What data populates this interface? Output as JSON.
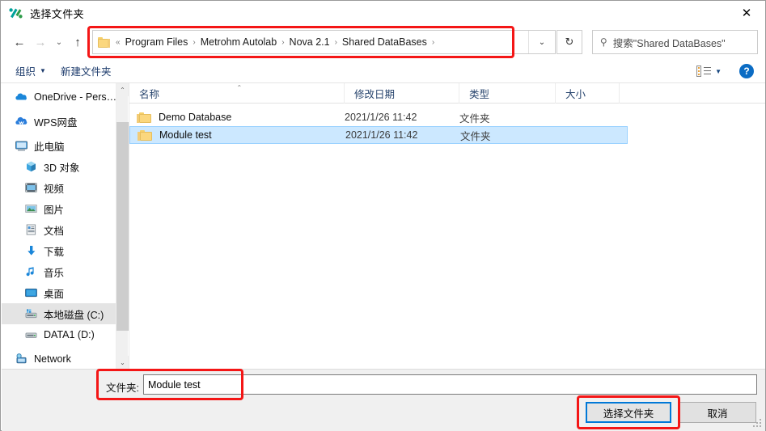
{
  "window": {
    "title": "选择文件夹",
    "icon": "autolab-logo-icon",
    "close_label": "✕"
  },
  "nav": {
    "back_label": "←",
    "forward_label": "→",
    "history_label": "⌄",
    "up_label": "↑"
  },
  "address": {
    "folder_icon": "folder-icon",
    "leading": "«",
    "crumbs": [
      "Program Files",
      "Metrohm Autolab",
      "Nova 2.1",
      "Shared DataBases"
    ],
    "separator": "›",
    "trailing_separator": "›",
    "caret_label": "⌄",
    "refresh_label": "↻"
  },
  "search": {
    "icon": "search-icon",
    "placeholder": "搜索\"Shared DataBases\"",
    "value": ""
  },
  "command_bar": {
    "organize_label": "组织",
    "organize_caret": "▼",
    "new_folder_label": "新建文件夹",
    "view_icon": "view-options-icon",
    "view_caret": "▼",
    "help_label": "?"
  },
  "sidebar": {
    "items": [
      {
        "label": "OneDrive - Pers…",
        "icon": "onedrive-cloud-icon",
        "indent": false,
        "selected": false
      },
      {
        "label": "WPS网盘",
        "icon": "wps-cloud-icon",
        "indent": false,
        "selected": false
      },
      {
        "label": "此电脑",
        "icon": "this-pc-icon",
        "indent": false,
        "selected": false
      },
      {
        "label": "3D 对象",
        "icon": "3d-objects-icon",
        "indent": true,
        "selected": false
      },
      {
        "label": "视频",
        "icon": "videos-icon",
        "indent": true,
        "selected": false
      },
      {
        "label": "图片",
        "icon": "pictures-icon",
        "indent": true,
        "selected": false
      },
      {
        "label": "文档",
        "icon": "documents-icon",
        "indent": true,
        "selected": false
      },
      {
        "label": "下载",
        "icon": "downloads-icon",
        "indent": true,
        "selected": false
      },
      {
        "label": "音乐",
        "icon": "music-icon",
        "indent": true,
        "selected": false
      },
      {
        "label": "桌面",
        "icon": "desktop-icon",
        "indent": true,
        "selected": false
      },
      {
        "label": "本地磁盘 (C:)",
        "icon": "local-disk-icon",
        "indent": true,
        "selected": true
      },
      {
        "label": "DATA1 (D:)",
        "icon": "hard-drive-icon",
        "indent": true,
        "selected": false
      },
      {
        "label": "Network",
        "icon": "network-icon",
        "indent": false,
        "selected": false
      }
    ],
    "scroll_up": "⌃",
    "scroll_down": "⌄"
  },
  "file_list": {
    "columns": [
      {
        "label": "名称",
        "sorted": true,
        "sort_mark": "⌃"
      },
      {
        "label": "修改日期",
        "sorted": false,
        "sort_mark": ""
      },
      {
        "label": "类型",
        "sorted": false,
        "sort_mark": ""
      },
      {
        "label": "大小",
        "sorted": false,
        "sort_mark": ""
      }
    ],
    "rows": [
      {
        "name": "Demo Database",
        "date": "2021/1/26 11:42",
        "type": "文件夹",
        "size": "",
        "selected": false,
        "icon": "folder-icon"
      },
      {
        "name": "Module test",
        "date": "2021/1/26 11:42",
        "type": "文件夹",
        "size": "",
        "selected": true,
        "icon": "folder-icon"
      }
    ]
  },
  "footer": {
    "folder_label": "文件夹:",
    "folder_value": "Module test",
    "select_button": "选择文件夹",
    "cancel_button": "取消"
  },
  "colors": {
    "selection_fill": "#cce8ff",
    "selection_border": "#99d1ff",
    "focus_border": "#0078d7",
    "annotation_red": "#f41616",
    "link_text": "#1b3a6b"
  }
}
